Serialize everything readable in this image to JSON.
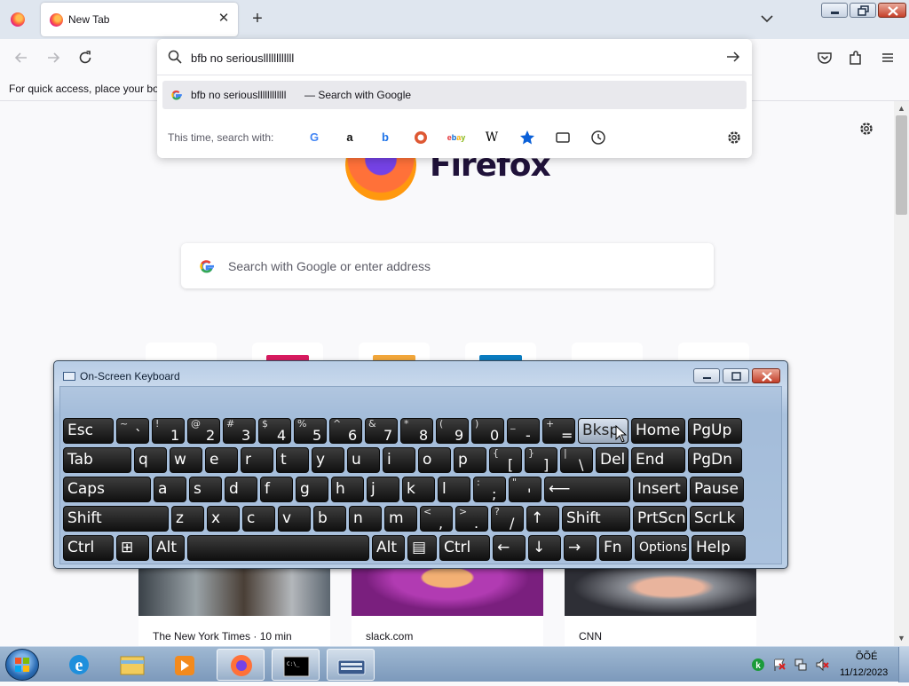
{
  "tab": {
    "title": "New Tab",
    "close": "✕"
  },
  "toolbar": {
    "new_tab": "+"
  },
  "urlbar": {
    "value": "bfb no seriousllllllllllll",
    "suggestion_text": "bfb no seriousllllllllllll",
    "suggestion_action": "— Search with Google",
    "search_with_label": "This time, search with:",
    "engines": [
      "google-icon",
      "amazon-icon",
      "bing-icon",
      "duckduckgo-icon",
      "ebay-icon",
      "wikipedia-icon",
      "bookmarks-icon",
      "tabs-icon",
      "history-icon"
    ]
  },
  "bookmarks_bar": {
    "hint": "For quick access, place your bookmarks here on the bookmarks toolbar."
  },
  "newtab": {
    "wordmark": "Firefox",
    "search_placeholder": "Search with Google or enter address",
    "stories": [
      {
        "source": "The New York Times · 10 min"
      },
      {
        "source": "slack.com"
      },
      {
        "source": "CNN"
      }
    ]
  },
  "osk": {
    "title": "On-Screen Keyboard",
    "rows": [
      [
        {
          "l": "Esc"
        },
        {
          "s": "~",
          "o": "`"
        },
        {
          "s": "!",
          "o": "1"
        },
        {
          "s": "@",
          "o": "2"
        },
        {
          "s": "#",
          "o": "3"
        },
        {
          "s": "$",
          "o": "4"
        },
        {
          "s": "%",
          "o": "5"
        },
        {
          "s": "^",
          "o": "6"
        },
        {
          "s": "&",
          "o": "7"
        },
        {
          "s": "*",
          "o": "8"
        },
        {
          "s": "(",
          "o": "9"
        },
        {
          "s": ")",
          "o": "0"
        },
        {
          "s": "_",
          "o": "-"
        },
        {
          "s": "+",
          "o": "="
        },
        {
          "l": "Bksp"
        },
        {
          "l": "Home"
        },
        {
          "l": "PgUp"
        }
      ],
      [
        {
          "l": "Tab"
        },
        {
          "l": "q"
        },
        {
          "l": "w"
        },
        {
          "l": "e"
        },
        {
          "l": "r"
        },
        {
          "l": "t"
        },
        {
          "l": "y"
        },
        {
          "l": "u"
        },
        {
          "l": "i"
        },
        {
          "l": "o"
        },
        {
          "l": "p"
        },
        {
          "s": "{",
          "o": "["
        },
        {
          "s": "}",
          "o": "]"
        },
        {
          "s": "|",
          "o": "\\"
        },
        {
          "l": "Del"
        },
        {
          "l": "End"
        },
        {
          "l": "PgDn"
        }
      ],
      [
        {
          "l": "Caps"
        },
        {
          "l": "a"
        },
        {
          "l": "s"
        },
        {
          "l": "d"
        },
        {
          "l": "f"
        },
        {
          "l": "g"
        },
        {
          "l": "h"
        },
        {
          "l": "j"
        },
        {
          "l": "k"
        },
        {
          "l": "l"
        },
        {
          "s": ":",
          "o": ";"
        },
        {
          "s": "\"",
          "o": "'"
        },
        {
          "l": "⟵"
        },
        {
          "l": "Insert"
        },
        {
          "l": "Pause"
        }
      ],
      [
        {
          "l": "Shift"
        },
        {
          "l": "z"
        },
        {
          "l": "x"
        },
        {
          "l": "c"
        },
        {
          "l": "v"
        },
        {
          "l": "b"
        },
        {
          "l": "n"
        },
        {
          "l": "m"
        },
        {
          "s": "<",
          "o": ","
        },
        {
          "s": ">",
          "o": "."
        },
        {
          "s": "?",
          "o": "/"
        },
        {
          "l": "↑"
        },
        {
          "l": "Shift"
        },
        {
          "l": "PrtScn"
        },
        {
          "l": "ScrLk"
        }
      ],
      [
        {
          "l": "Ctrl"
        },
        {
          "l": "⊞"
        },
        {
          "l": "Alt"
        },
        {
          "l": ""
        },
        {
          "l": "Alt"
        },
        {
          "l": "▤"
        },
        {
          "l": "Ctrl"
        },
        {
          "l": "←"
        },
        {
          "l": "↓"
        },
        {
          "l": "→"
        },
        {
          "l": "Fn"
        },
        {
          "l": "Options"
        },
        {
          "l": "Help"
        }
      ]
    ]
  },
  "taskbar": {
    "time": "ÕÕÉ",
    "date": "11/12/2023"
  }
}
